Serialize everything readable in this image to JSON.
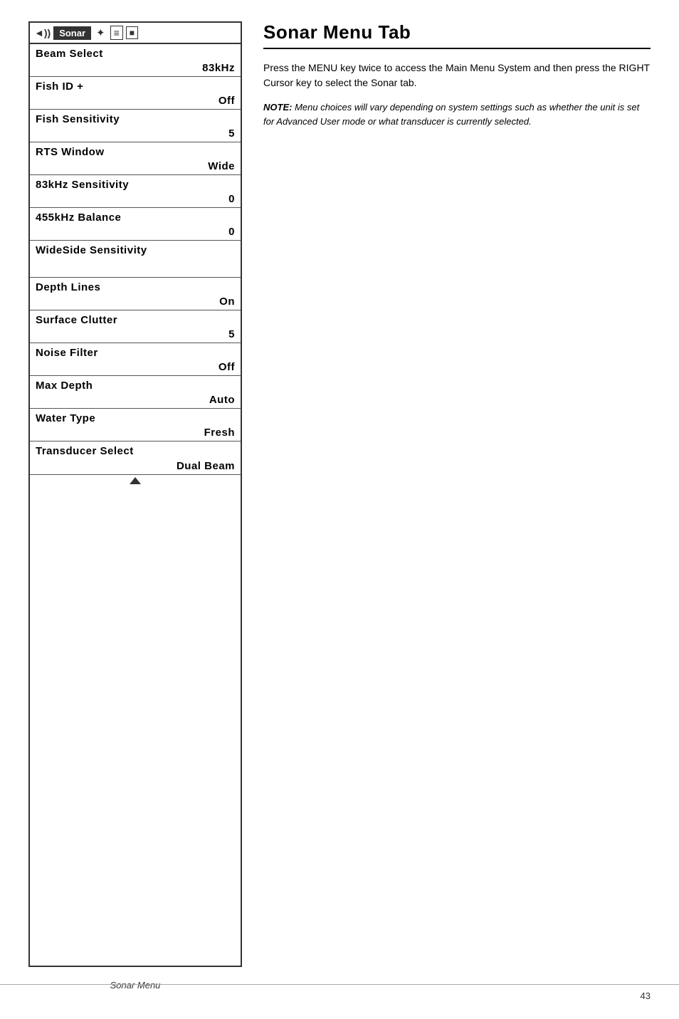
{
  "header": {
    "tab_label": "Sonar Menu Tab"
  },
  "tab_bar": {
    "icon_sound": "◄))",
    "tab_name": "Sonar",
    "icon_gear": "✦",
    "icon_menu1": "≡",
    "icon_menu2": "■"
  },
  "menu_items": [
    {
      "label": "Beam Select",
      "value": "83kHz"
    },
    {
      "label": "Fish ID +",
      "value": "Off"
    },
    {
      "label": "Fish Sensitivity",
      "value": "5"
    },
    {
      "label": "RTS Window",
      "value": "Wide"
    },
    {
      "label": "83kHz Sensitivity",
      "value": "0"
    },
    {
      "label": "455kHz Balance",
      "value": "0"
    },
    {
      "label": "WideSide Sensitivity",
      "value": ""
    },
    {
      "label": "Depth Lines",
      "value": "On"
    },
    {
      "label": "Surface Clutter",
      "value": "5"
    },
    {
      "label": "Noise Filter",
      "value": "Off"
    },
    {
      "label": "Max Depth",
      "value": "Auto"
    },
    {
      "label": "Water Type",
      "value": "Fresh"
    },
    {
      "label": "Transducer Select",
      "value": "Dual Beam"
    }
  ],
  "description": {
    "text": "Press the MENU key twice to access the Main Menu System and then press the RIGHT Cursor key to select the Sonar tab."
  },
  "note": {
    "label": "NOTE:",
    "text": " Menu choices will vary depending on system settings such as whether the unit is set for Advanced User mode or what transducer is currently selected."
  },
  "caption": "Sonar Menu",
  "page_number": "43"
}
